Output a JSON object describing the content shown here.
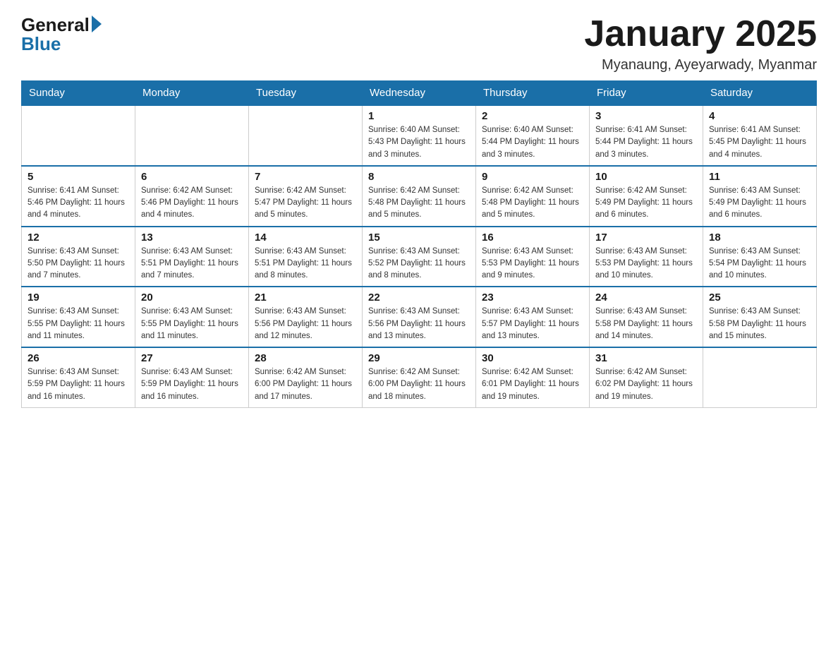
{
  "logo": {
    "general": "General",
    "blue": "Blue"
  },
  "title": "January 2025",
  "subtitle": "Myanaung, Ayeyarwady, Myanmar",
  "days_header": [
    "Sunday",
    "Monday",
    "Tuesday",
    "Wednesday",
    "Thursday",
    "Friday",
    "Saturday"
  ],
  "weeks": [
    [
      {
        "day": "",
        "info": ""
      },
      {
        "day": "",
        "info": ""
      },
      {
        "day": "",
        "info": ""
      },
      {
        "day": "1",
        "info": "Sunrise: 6:40 AM\nSunset: 5:43 PM\nDaylight: 11 hours\nand 3 minutes."
      },
      {
        "day": "2",
        "info": "Sunrise: 6:40 AM\nSunset: 5:44 PM\nDaylight: 11 hours\nand 3 minutes."
      },
      {
        "day": "3",
        "info": "Sunrise: 6:41 AM\nSunset: 5:44 PM\nDaylight: 11 hours\nand 3 minutes."
      },
      {
        "day": "4",
        "info": "Sunrise: 6:41 AM\nSunset: 5:45 PM\nDaylight: 11 hours\nand 4 minutes."
      }
    ],
    [
      {
        "day": "5",
        "info": "Sunrise: 6:41 AM\nSunset: 5:46 PM\nDaylight: 11 hours\nand 4 minutes."
      },
      {
        "day": "6",
        "info": "Sunrise: 6:42 AM\nSunset: 5:46 PM\nDaylight: 11 hours\nand 4 minutes."
      },
      {
        "day": "7",
        "info": "Sunrise: 6:42 AM\nSunset: 5:47 PM\nDaylight: 11 hours\nand 5 minutes."
      },
      {
        "day": "8",
        "info": "Sunrise: 6:42 AM\nSunset: 5:48 PM\nDaylight: 11 hours\nand 5 minutes."
      },
      {
        "day": "9",
        "info": "Sunrise: 6:42 AM\nSunset: 5:48 PM\nDaylight: 11 hours\nand 5 minutes."
      },
      {
        "day": "10",
        "info": "Sunrise: 6:42 AM\nSunset: 5:49 PM\nDaylight: 11 hours\nand 6 minutes."
      },
      {
        "day": "11",
        "info": "Sunrise: 6:43 AM\nSunset: 5:49 PM\nDaylight: 11 hours\nand 6 minutes."
      }
    ],
    [
      {
        "day": "12",
        "info": "Sunrise: 6:43 AM\nSunset: 5:50 PM\nDaylight: 11 hours\nand 7 minutes."
      },
      {
        "day": "13",
        "info": "Sunrise: 6:43 AM\nSunset: 5:51 PM\nDaylight: 11 hours\nand 7 minutes."
      },
      {
        "day": "14",
        "info": "Sunrise: 6:43 AM\nSunset: 5:51 PM\nDaylight: 11 hours\nand 8 minutes."
      },
      {
        "day": "15",
        "info": "Sunrise: 6:43 AM\nSunset: 5:52 PM\nDaylight: 11 hours\nand 8 minutes."
      },
      {
        "day": "16",
        "info": "Sunrise: 6:43 AM\nSunset: 5:53 PM\nDaylight: 11 hours\nand 9 minutes."
      },
      {
        "day": "17",
        "info": "Sunrise: 6:43 AM\nSunset: 5:53 PM\nDaylight: 11 hours\nand 10 minutes."
      },
      {
        "day": "18",
        "info": "Sunrise: 6:43 AM\nSunset: 5:54 PM\nDaylight: 11 hours\nand 10 minutes."
      }
    ],
    [
      {
        "day": "19",
        "info": "Sunrise: 6:43 AM\nSunset: 5:55 PM\nDaylight: 11 hours\nand 11 minutes."
      },
      {
        "day": "20",
        "info": "Sunrise: 6:43 AM\nSunset: 5:55 PM\nDaylight: 11 hours\nand 11 minutes."
      },
      {
        "day": "21",
        "info": "Sunrise: 6:43 AM\nSunset: 5:56 PM\nDaylight: 11 hours\nand 12 minutes."
      },
      {
        "day": "22",
        "info": "Sunrise: 6:43 AM\nSunset: 5:56 PM\nDaylight: 11 hours\nand 13 minutes."
      },
      {
        "day": "23",
        "info": "Sunrise: 6:43 AM\nSunset: 5:57 PM\nDaylight: 11 hours\nand 13 minutes."
      },
      {
        "day": "24",
        "info": "Sunrise: 6:43 AM\nSunset: 5:58 PM\nDaylight: 11 hours\nand 14 minutes."
      },
      {
        "day": "25",
        "info": "Sunrise: 6:43 AM\nSunset: 5:58 PM\nDaylight: 11 hours\nand 15 minutes."
      }
    ],
    [
      {
        "day": "26",
        "info": "Sunrise: 6:43 AM\nSunset: 5:59 PM\nDaylight: 11 hours\nand 16 minutes."
      },
      {
        "day": "27",
        "info": "Sunrise: 6:43 AM\nSunset: 5:59 PM\nDaylight: 11 hours\nand 16 minutes."
      },
      {
        "day": "28",
        "info": "Sunrise: 6:42 AM\nSunset: 6:00 PM\nDaylight: 11 hours\nand 17 minutes."
      },
      {
        "day": "29",
        "info": "Sunrise: 6:42 AM\nSunset: 6:00 PM\nDaylight: 11 hours\nand 18 minutes."
      },
      {
        "day": "30",
        "info": "Sunrise: 6:42 AM\nSunset: 6:01 PM\nDaylight: 11 hours\nand 19 minutes."
      },
      {
        "day": "31",
        "info": "Sunrise: 6:42 AM\nSunset: 6:02 PM\nDaylight: 11 hours\nand 19 minutes."
      },
      {
        "day": "",
        "info": ""
      }
    ]
  ]
}
